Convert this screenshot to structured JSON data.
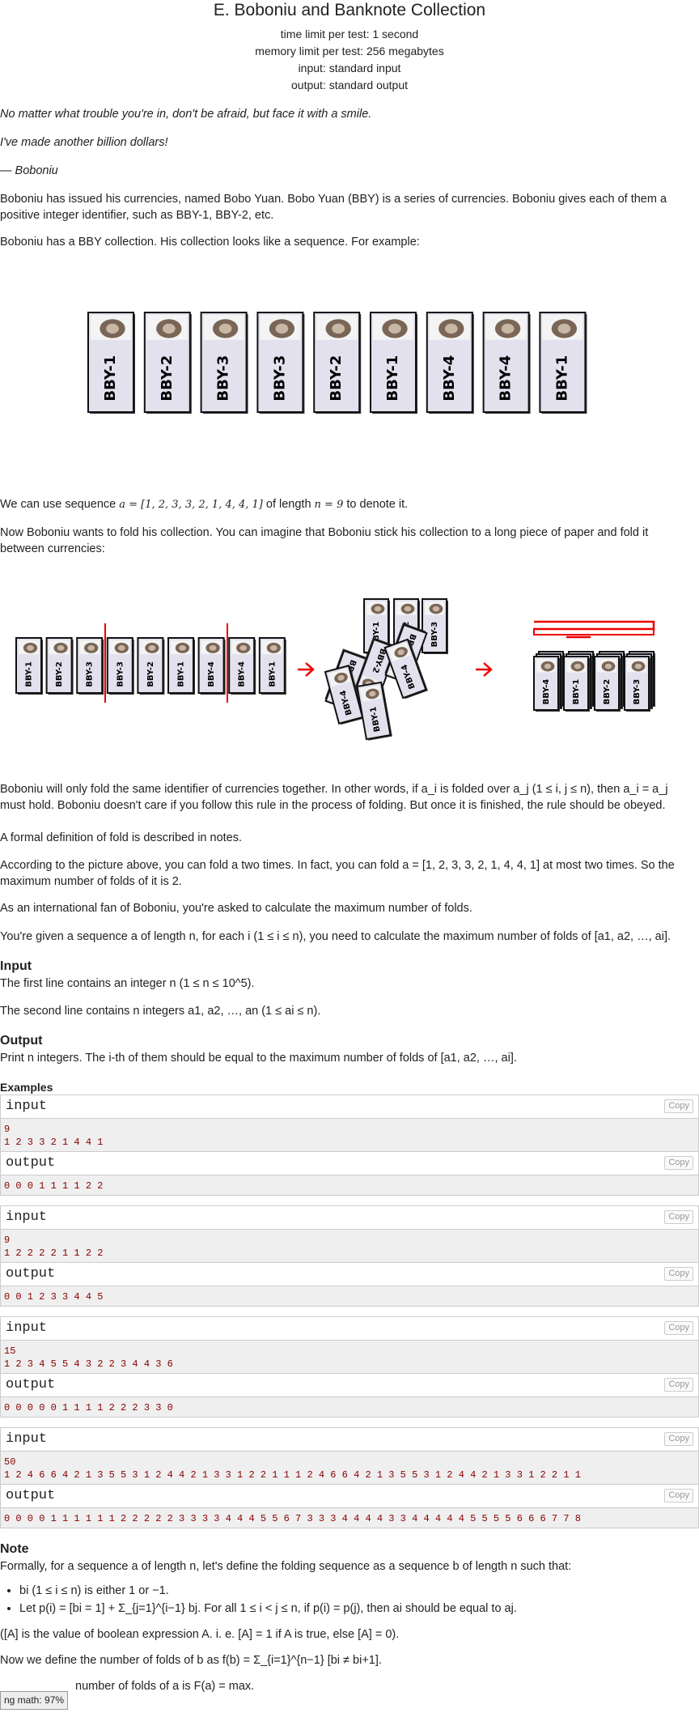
{
  "header": {
    "title": "E. Boboniu and Banknote Collection",
    "time_limit": "time limit per test: 1 second",
    "memory_limit": "memory limit per test: 256 megabytes",
    "input": "input: standard input",
    "output": "output: standard output"
  },
  "legend": {
    "quote1": "No matter what trouble you're in, don't be afraid, but face it with a smile.",
    "quote2": "I've made another billion dollars!",
    "quote3": "— Boboniu",
    "p1": "Boboniu has issued his currencies, named Bobo Yuan. Bobo Yuan (BBY) is a series of currencies. Boboniu gives each of them a positive integer identifier, such as BBY-1, BBY-2, etc.",
    "p2": "Boboniu has a BBY collection. His collection looks like a sequence. For example:",
    "notes_banknotes": [
      "BBY-1",
      "BBY-2",
      "BBY-3",
      "BBY-3",
      "BBY-2",
      "BBY-1",
      "BBY-4",
      "BBY-4",
      "BBY-1"
    ],
    "p3_a": "We can use sequence ",
    "p3_math": "a = [1, 2, 3, 3, 2, 1, 4, 4, 1]",
    "p3_b": " of length ",
    "p3_n": "n = 9",
    "p3_c": " to denote it.",
    "p4": "Now Boboniu wants to fold his collection. You can imagine that Boboniu stick his collection to a long piece of paper and fold it between currencies:",
    "p5": "Boboniu will only fold the same identifier of currencies together. In other words, if a_i is folded over a_j (1 ≤ i, j ≤ n), then a_i = a_j must hold. Boboniu doesn't care if you follow this rule in the process of folding. But once it is finished, the rule should be obeyed.",
    "p6": "A formal definition of fold is described in notes.",
    "p7": "According to the picture above, you can fold a two times. In fact, you can fold a = [1, 2, 3, 3, 2, 1, 4, 4, 1] at most two times. So the maximum number of folds of it is 2.",
    "p8": "As an international fan of Boboniu, you're asked to calculate the maximum number of folds.",
    "p9": "You're given a sequence a of length n, for each i (1 ≤ i ≤ n), you need to calculate the maximum number of folds of [a1, a2, …, ai]."
  },
  "input_spec": {
    "title": "Input",
    "line1": "The first line contains an integer n (1 ≤ n ≤ 10^5).",
    "line2": "The second line contains n integers a1, a2, …, an (1 ≤ ai ≤ n)."
  },
  "output_spec": {
    "title": "Output",
    "line1": "Print n integers. The i-th of them should be equal to the maximum number of folds of [a1, a2, …, ai]."
  },
  "examples": {
    "title": "Examples",
    "input_label": "input",
    "output_label": "output",
    "copy_label": "Copy",
    "tests": [
      {
        "input": "9\n1 2 3 3 2 1 4 4 1",
        "output": "0 0 0 1 1 1 1 2 2"
      },
      {
        "input": "9\n1 2 2 2 2 1 1 2 2",
        "output": "0 0 1 2 3 3 4 4 5"
      },
      {
        "input": "15\n1 2 3 4 5 5 4 3 2 2 3 4 4 3 6",
        "output": "0 0 0 0 0 1 1 1 1 2 2 2 3 3 0"
      },
      {
        "input": "50\n1 2 4 6 6 4 2 1 3 5 5 3 1 2 4 4 2 1 3 3 1 2 2 1 1 1 2 4 6 6 4 2 1 3 5 5 3 1 2 4 4 2 1 3 3 1 2 2 1 1",
        "output": "0 0 0 0 1 1 1 1 1 1 2 2 2 2 2 3 3 3 3 4 4 4 5 5 6 7 3 3 3 4 4 4 4 3 3 4 4 4 4 4 5 5 5 5 6 6 6 7 7 8"
      }
    ]
  },
  "note": {
    "title": "Note",
    "intro": "Formally, for a sequence a of length n, let's define the folding sequence as a sequence b of length n such that:",
    "bullet1": "bi (1 ≤ i ≤ n) is either 1 or −1.",
    "bullet2": "Let p(i) = [bi = 1] + Σ_{j=1}^{i−1} bj. For all 1 ≤ i < j ≤ n, if p(i) = p(j), then ai should be equal to aj.",
    "iverson": "([A] is the value of boolean expression A. i. e. [A] = 1 if A is true, else [A] = 0).",
    "folds_def": "Now we define the number of folds of b as f(b) = Σ_{i=1}^{n−1} [bi ≠ bi+1].",
    "last": "number of folds of a is F(a) = max."
  },
  "math_badge": "ng math: 97%"
}
